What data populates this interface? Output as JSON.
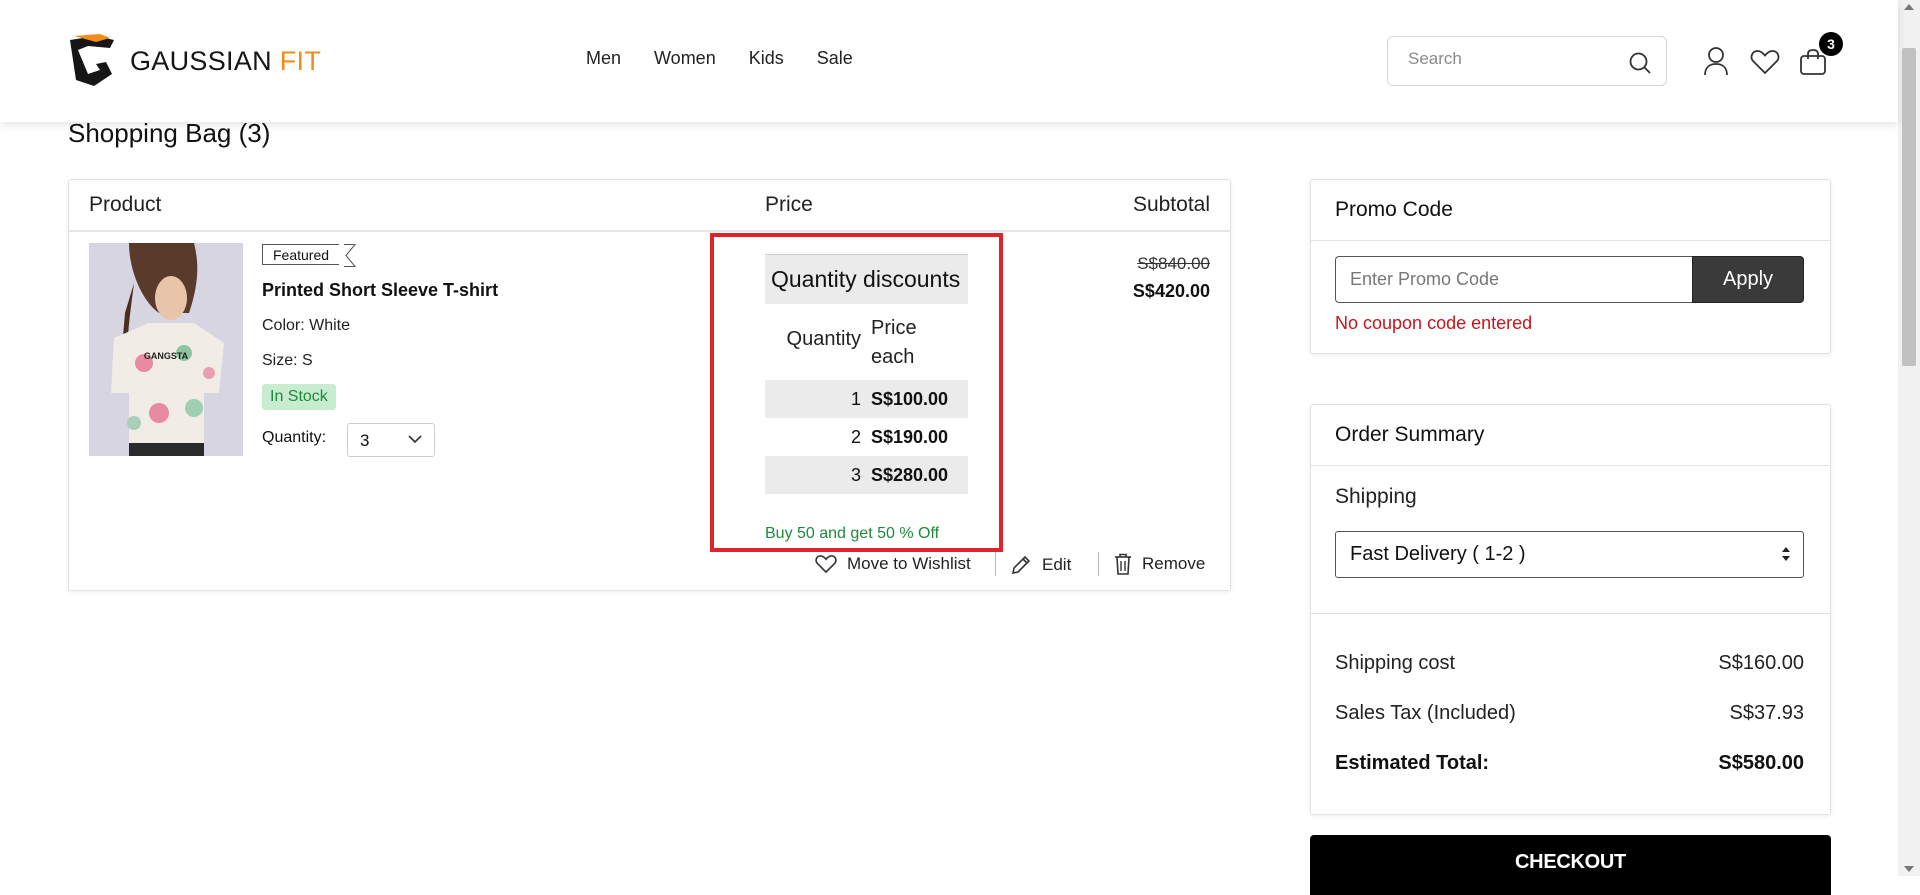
{
  "brand": {
    "name_primary": "GAUSSIAN",
    "name_accent": "FIT",
    "accent_color": "#f28c18"
  },
  "nav": [
    "Men",
    "Women",
    "Kids",
    "Sale"
  ],
  "search": {
    "placeholder": "Search"
  },
  "header": {
    "cart_count": "3"
  },
  "page": {
    "title": "Shopping Bag (3)"
  },
  "cart": {
    "columns": {
      "product": "Product",
      "price": "Price",
      "subtotal": "Subtotal"
    },
    "item": {
      "badge": "Featured",
      "name": "Printed Short Sleeve T-shirt",
      "color": "Color: White",
      "size": "Size: S",
      "stock": "In Stock",
      "quantity_label": "Quantity:",
      "quantity_value": "3",
      "image_text": "GANGSTA",
      "original_price": "S$840.00",
      "price": "S$420.00"
    },
    "quantity_discounts": {
      "title": "Quantity discounts",
      "header_qty": "Quantity",
      "header_price_line1": "Price",
      "header_price_line2": "each",
      "rows": [
        {
          "qty": "1",
          "price": "S$100.00"
        },
        {
          "qty": "2",
          "price": "S$190.00"
        },
        {
          "qty": "3",
          "price": "S$280.00"
        }
      ],
      "note": "Buy 50 and get 50 % Off"
    },
    "actions": {
      "wishlist": "Move to Wishlist",
      "edit": "Edit",
      "remove": "Remove"
    }
  },
  "promo": {
    "title": "Promo Code",
    "placeholder": "Enter Promo Code",
    "apply": "Apply",
    "error": "No coupon code entered"
  },
  "summary": {
    "title": "Order Summary",
    "shipping_label": "Shipping",
    "shipping_option": "Fast Delivery ( 1-2 )",
    "shipping_cost_label": "Shipping cost",
    "shipping_cost": "S$160.00",
    "tax_label": "Sales Tax (Included)",
    "tax": "S$37.93",
    "total_label": "Estimated Total:",
    "total": "S$580.00",
    "checkout": "CHECKOUT"
  }
}
